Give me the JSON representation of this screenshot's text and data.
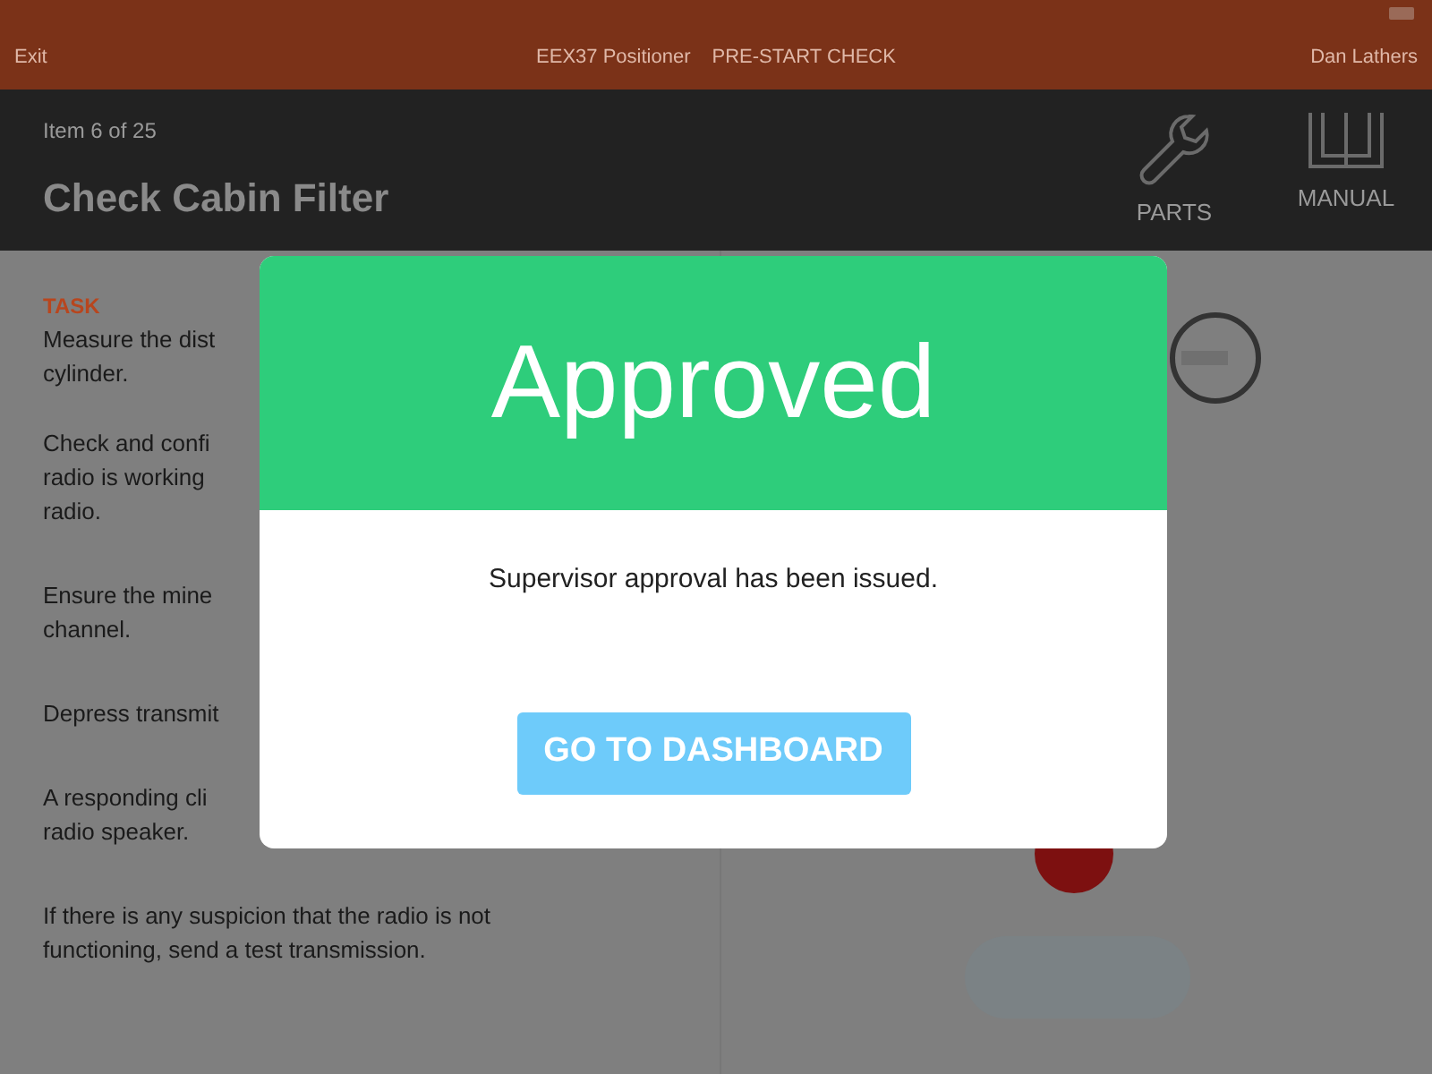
{
  "nav_bar": {
    "exit": "Exit",
    "title": "EEX37 Positioner",
    "subtitle": "PRE-START CHECK",
    "user": "Dan Lathers"
  },
  "header": {
    "progress": "Item 6 of 25",
    "title": "Check Cabin Filter",
    "actions": [
      {
        "kind": "wrench",
        "label": "PARTS"
      },
      {
        "kind": "book",
        "label": "MANUAL"
      }
    ]
  },
  "task": {
    "heading": "TASK",
    "paragraphs": [
      {
        "lines": [
          "Measure the dist",
          "cylinder."
        ]
      },
      {
        "lines": [
          "Check and confi",
          "radio is working",
          "radio."
        ]
      },
      {
        "lines": [
          "Ensure the mine",
          "channel."
        ]
      },
      {
        "lines": [
          "Depress transmit"
        ]
      },
      {
        "lines": [
          "A responding cli",
          "radio speaker."
        ]
      },
      {
        "lines": [
          "If there is any suspicion that the radio is not",
          "functioning, send a test transmission."
        ]
      }
    ]
  },
  "dialog": {
    "title": "Approved",
    "message": "Supervisor approval has been issued.",
    "button": "GO TO DASHBOARD"
  }
}
